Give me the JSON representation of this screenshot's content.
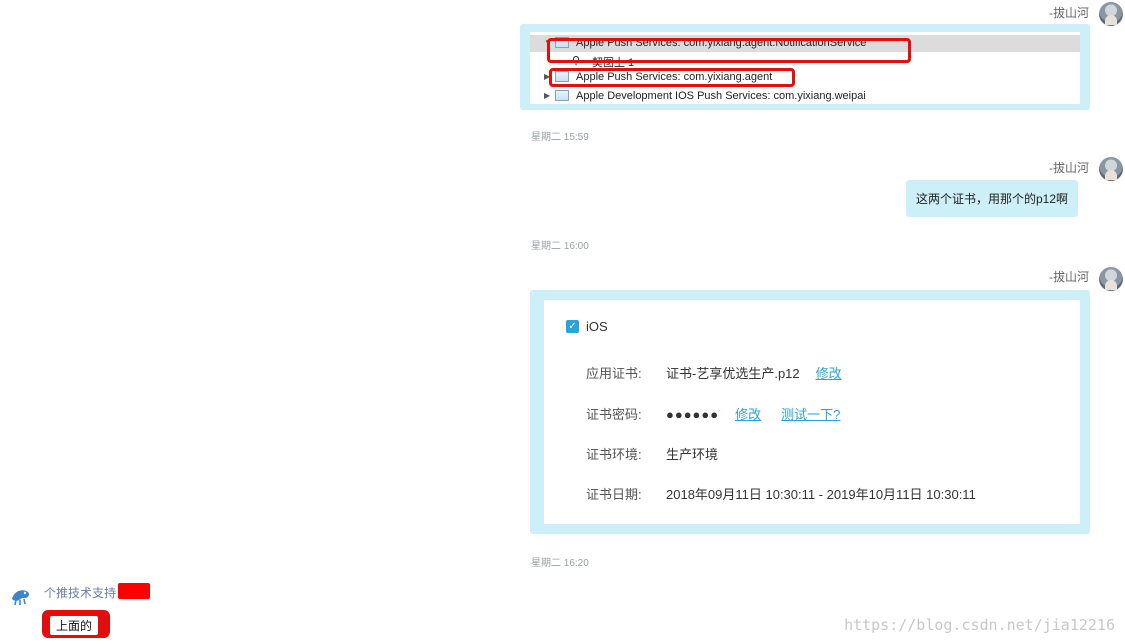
{
  "messages": {
    "m1": {
      "sender": "-拔山河",
      "keychain": {
        "row1": "Apple Push Services: com.yixiang.agent.NotificationService",
        "row2": "契图上 1",
        "row3": "Apple Push Services: com.yixiang.agent",
        "row4": "Apple Development IOS Push Services: com.yixiang.weipai"
      }
    },
    "ts1": "星期二  15:59",
    "m2": {
      "sender": "-拔山河",
      "text": "这两个证书，用那个的p12啊"
    },
    "ts2": "星期二  16:00",
    "m3": {
      "sender": "-拔山河",
      "platform": "iOS",
      "fields": [
        {
          "label": "应用证书:",
          "value": "证书-艺享优选生产.p12",
          "link1": "修改",
          "link2": ""
        },
        {
          "label": "证书密码:",
          "value": "●●●●●●",
          "link1": "修改",
          "link2": "测试一下?"
        },
        {
          "label": "证书环境:",
          "value": "生产环境",
          "link1": "",
          "link2": ""
        },
        {
          "label": "证书日期:",
          "value": "2018年09月11日 10:30:11 - 2019年10月11日 10:30:11",
          "link1": "",
          "link2": ""
        }
      ]
    },
    "ts3": "星期二  16:20",
    "incoming": {
      "sender": "个推技术支持",
      "text": "上面的"
    }
  },
  "watermark": "https://blog.csdn.net/jia12216",
  "colors": {
    "bubble": "#cdeff8",
    "accent": "#2aa3d9",
    "highlight": "#e01010"
  },
  "icons": {
    "check": "checkmark-icon",
    "avatar": "user-avatar",
    "bot": "bird-avatar"
  }
}
